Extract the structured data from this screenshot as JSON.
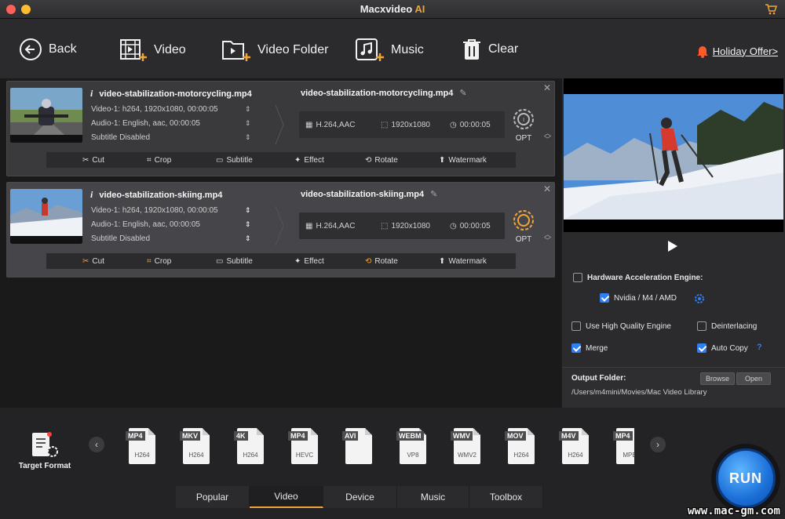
{
  "app": {
    "title_main": "Macxvideo",
    "title_accent": "AI"
  },
  "toolbar": {
    "back": "Back",
    "video": "Video",
    "video_folder": "Video Folder",
    "music": "Music",
    "clear": "Clear",
    "offer": "Holiday Offer>"
  },
  "files": [
    {
      "source_name": "video-stabilization-motorcycling.mp4",
      "video_line": "Video-1: h264, 1920x1080, 00:00:05",
      "audio_line": "Audio-1: English, aac, 00:00:05",
      "subtitle_line": "Subtitle Disabled",
      "output_name": "video-stabilization-motorcycling.mp4",
      "codec": "H.264,AAC",
      "resolution": "1920x1080",
      "duration": "00:00:05",
      "opt": "OPT"
    },
    {
      "source_name": "video-stabilization-skiing.mp4",
      "video_line": "Video-1: h264, 1920x1080, 00:00:05",
      "audio_line": "Audio-1: English, aac, 00:00:05",
      "subtitle_line": "Subtitle Disabled",
      "output_name": "video-stabilization-skiing.mp4",
      "codec": "H.264,AAC",
      "resolution": "1920x1080",
      "duration": "00:00:05",
      "opt": "OPT"
    }
  ],
  "edit_tools": {
    "cut": "Cut",
    "crop": "Crop",
    "subtitle": "Subtitle",
    "effect": "Effect",
    "rotate": "Rotate",
    "watermark": "Watermark"
  },
  "options": {
    "hw_engine": "Hardware Acceleration Engine:",
    "hw_vendor": "Nvidia / M4 / AMD",
    "high_quality": "Use High Quality Engine",
    "deinterlacing": "Deinterlacing",
    "merge": "Merge",
    "auto_copy": "Auto Copy",
    "help": "?"
  },
  "output": {
    "label": "Output Folder:",
    "path": "/Users/m4mini/Movies/Mac Video Library",
    "browse": "Browse",
    "open": "Open"
  },
  "target_format": "Target Format",
  "formats": [
    {
      "tag": "MP4",
      "codec": "H264"
    },
    {
      "tag": "MKV",
      "codec": "H264"
    },
    {
      "tag": "4K",
      "codec": "H264"
    },
    {
      "tag": "MP4",
      "codec": "HEVC"
    },
    {
      "tag": "AVI",
      "codec": ""
    },
    {
      "tag": "WEBM",
      "codec": "VP8"
    },
    {
      "tag": "WMV",
      "codec": "WMV2"
    },
    {
      "tag": "MOV",
      "codec": "H264"
    },
    {
      "tag": "M4V",
      "codec": "H264"
    },
    {
      "tag": "MP4",
      "codec": "MPE"
    }
  ],
  "tabs": [
    "Popular",
    "Video",
    "Device",
    "Music",
    "Toolbox"
  ],
  "run": "RUN",
  "watermark": "www.mac-gm.com",
  "colors": {
    "accent": "#f0a53a",
    "check": "#2f7ff0",
    "offer_bell": "#ff5a2a",
    "run": "#1b6fd8"
  }
}
